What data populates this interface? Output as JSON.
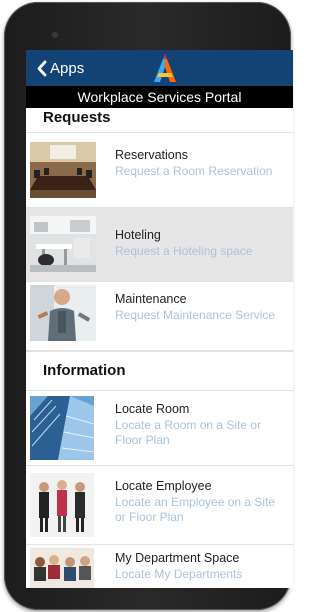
{
  "header": {
    "back_label": "Apps",
    "logo": "apps-logo-icon",
    "portal_title": "Workplace Services Portal"
  },
  "sections": {
    "requests": {
      "title": "Requests",
      "items": [
        {
          "title": "Reservations",
          "subtitle": "Request a Room Reservation",
          "icon": "conference-room-image"
        },
        {
          "title": "Hoteling",
          "subtitle": "Request a Hoteling space",
          "icon": "office-desk-image",
          "selected": true
        },
        {
          "title": "Maintenance",
          "subtitle": "Request Maintenance Service",
          "icon": "maintenance-worker-image"
        }
      ]
    },
    "information": {
      "title": "Information",
      "items": [
        {
          "title": "Locate Room",
          "subtitle": "Locate a Room on a Site or Floor Plan",
          "icon": "office-building-image"
        },
        {
          "title": "Locate Employee",
          "subtitle": "Locate an Employee on a Site or Floor Plan",
          "icon": "employees-image"
        },
        {
          "title": "My Department Space",
          "subtitle": "Locate My Departments",
          "icon": "department-team-image"
        }
      ]
    }
  },
  "colors": {
    "appbar": "#134375",
    "titlebar": "#000000",
    "subtitle": "#a9c3de",
    "selected_row": "#e6e6e6"
  }
}
